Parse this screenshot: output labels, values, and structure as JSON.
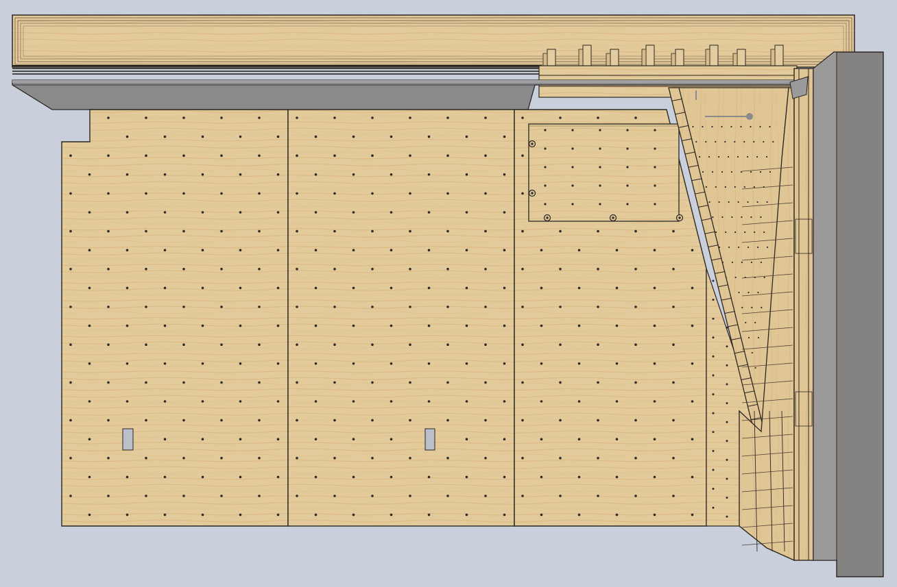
{
  "scene": {
    "viewport_name": "cad-3d-viewport",
    "background": "#c9d0db",
    "wood_color": "#e2c99a",
    "wood_grain_color": "#d8b27a",
    "outline_color": "#2a2622",
    "hole_color": "#2e2a26",
    "beam_color": "#7e7e80",
    "pillar_color": "#848280",
    "cutout_color": "#b9bfcb"
  },
  "model": {
    "panels": [
      "left-wall-panel",
      "middle-wall-panel",
      "right-wall-panel",
      "angled-side-panel"
    ],
    "components": [
      "ceiling-joist-stack",
      "steel-ledger-beam",
      "concrete-pillar",
      "hold-board",
      "diagonal-ladder",
      "vertical-corner-post"
    ],
    "cutouts": 2,
    "hold_board_bolts": 5
  }
}
